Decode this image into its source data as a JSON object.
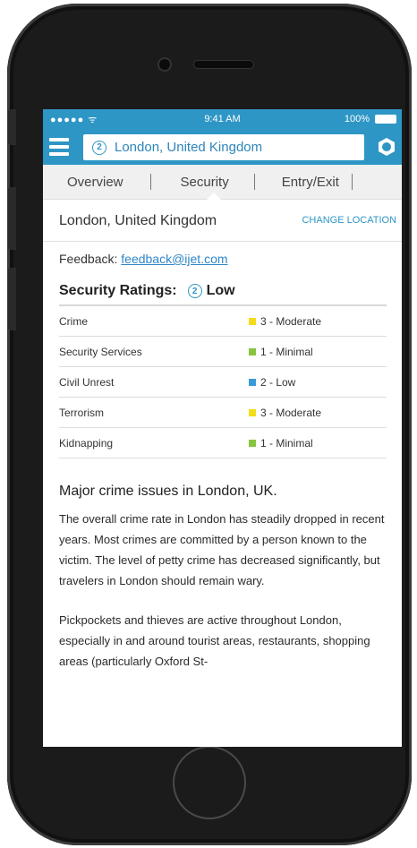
{
  "status_bar": {
    "signal": "●●●●● ᯤ",
    "time": "9:41 AM",
    "battery": "100%"
  },
  "header": {
    "search_badge": "2",
    "search_value": "London, United Kingdom"
  },
  "tabs": [
    {
      "label": "Overview"
    },
    {
      "label": "Security",
      "active": true
    },
    {
      "label": "Entry/Exit"
    }
  ],
  "location": {
    "name": "London, United Kingdom",
    "change_label": "CHANGE LOCATION"
  },
  "feedback": {
    "label": "Feedback:",
    "email": "feedback@ijet.com"
  },
  "security": {
    "heading": "Security Ratings:",
    "badge": "2",
    "overall": "Low",
    "rows": [
      {
        "category": "Crime",
        "rating": "3 - Moderate",
        "color": "#f2dc1c"
      },
      {
        "category": "Security Services",
        "rating": "1 - Minimal",
        "color": "#88c440"
      },
      {
        "category": "Civil Unrest",
        "rating": "2 - Low",
        "color": "#3a9ad8"
      },
      {
        "category": "Terrorism",
        "rating": "3 - Moderate",
        "color": "#f2dc1c"
      },
      {
        "category": "Kidnapping",
        "rating": "1 - Minimal",
        "color": "#88c440"
      }
    ]
  },
  "crime": {
    "title": "Major crime issues in London, UK.",
    "paragraph1": "The overall crime rate in London has steadily dropped in recent years. Most crimes are committed by a person known to the victim. The level of petty crime has decreased significantly, but travelers in London should remain wary.",
    "paragraph2": "Pickpockets and thieves are active throughout London, especially in and around tourist areas, restaurants, shopping areas (particularly Oxford St-"
  },
  "colors": {
    "accent": "#2e96c5",
    "link": "#2e86c8"
  }
}
